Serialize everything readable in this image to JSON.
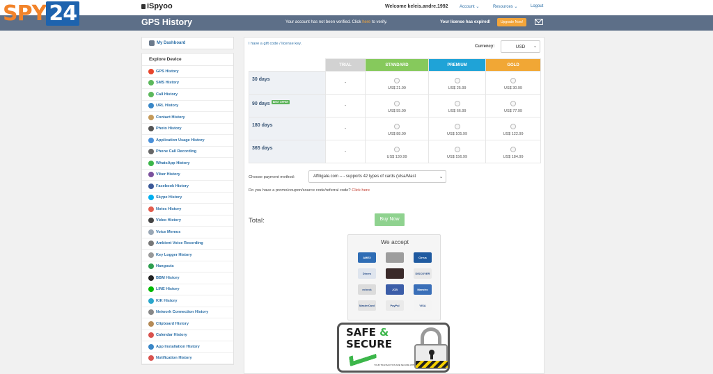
{
  "watermark": {
    "spy": "SPY",
    "num": "24"
  },
  "topbar": {
    "logo": "iSpyoo",
    "welcome": "Welcome keleis.andre.1992",
    "nav": [
      {
        "label": "Account",
        "has_dropdown": true
      },
      {
        "label": "Resources",
        "has_dropdown": true
      },
      {
        "label": "Logout",
        "has_dropdown": false
      }
    ],
    "chevron": "⌄"
  },
  "header": {
    "title": "GPS History",
    "verify_before": "Your account has not been verified. Click ",
    "verify_link": "here",
    "verify_after": " to verify.",
    "license_text": "Your license has expired!",
    "upgrade_label": "Upgrade Now!"
  },
  "sidebar": {
    "dashboard": "My Dashboard",
    "explore_title": "Explore Device",
    "items": [
      {
        "label": "GPS History",
        "icon": "map-pin-icon",
        "color": "#e8452c"
      },
      {
        "label": "SMS History",
        "icon": "sms-icon",
        "color": "#5cb85c"
      },
      {
        "label": "Call History",
        "icon": "phone-icon",
        "color": "#5cb85c"
      },
      {
        "label": "URL History",
        "icon": "globe-icon",
        "color": "#3a87c7"
      },
      {
        "label": "Contact History",
        "icon": "contacts-icon",
        "color": "#c59a5a"
      },
      {
        "label": "Photo History",
        "icon": "camera-icon",
        "color": "#555555"
      },
      {
        "label": "Application Usage History",
        "icon": "app-icon",
        "color": "#4a90d9"
      },
      {
        "label": "Phone Call Recording",
        "icon": "recorder-icon",
        "color": "#666666"
      },
      {
        "label": "WhatsApp History",
        "icon": "whatsapp-icon",
        "color": "#3cb64a"
      },
      {
        "label": "Viber History",
        "icon": "viber-icon",
        "color": "#7b519d"
      },
      {
        "label": "Facebook History",
        "icon": "facebook-icon",
        "color": "#3b5998"
      },
      {
        "label": "Skype History",
        "icon": "skype-icon",
        "color": "#00aff0"
      },
      {
        "label": "Notes History",
        "icon": "notes-icon",
        "color": "#e35d4e"
      },
      {
        "label": "Video History",
        "icon": "video-icon",
        "color": "#444444"
      },
      {
        "label": "Voice Memos",
        "icon": "microphone-icon",
        "color": "#9aa7b5"
      },
      {
        "label": "Ambient Voice Recording",
        "icon": "ambient-icon",
        "color": "#777777"
      },
      {
        "label": "Key Logger History",
        "icon": "keyboard-icon",
        "color": "#999999"
      },
      {
        "label": "Hangouts",
        "icon": "hangouts-icon",
        "color": "#2e9e4f"
      },
      {
        "label": "BBM History",
        "icon": "bbm-icon",
        "color": "#222222"
      },
      {
        "label": "LINE History",
        "icon": "line-icon",
        "color": "#00b900"
      },
      {
        "label": "KIK History",
        "icon": "kik-icon",
        "color": "#2aa7cc"
      },
      {
        "label": "Network Connection History",
        "icon": "wifi-icon",
        "color": "#888888"
      },
      {
        "label": "Clipboard History",
        "icon": "clipboard-icon",
        "color": "#b58b58"
      },
      {
        "label": "Calendar History",
        "icon": "calendar-icon",
        "color": "#d9534f"
      },
      {
        "label": "App Installation History",
        "icon": "install-icon",
        "color": "#3a87c7"
      },
      {
        "label": "Notification History",
        "icon": "notification-icon",
        "color": "#d9534f"
      }
    ]
  },
  "main": {
    "gift_link": "I have a gift code / license key.",
    "currency_label": "Currency:",
    "currency_value": "USD",
    "plans": [
      "TRIAL",
      "STANDARD",
      "PREMIUM",
      "GOLD"
    ],
    "rows": [
      {
        "period": "30 days",
        "badge": "",
        "trial": "-",
        "prices": [
          "US$ 21.99",
          "US$ 25.99",
          "US$ 30.99"
        ]
      },
      {
        "period": "90 days",
        "badge": "BEST OFFER",
        "trial": "-",
        "prices": [
          "US$ 55.99",
          "US$ 66.99",
          "US$ 77.99"
        ]
      },
      {
        "period": "180 days",
        "badge": "",
        "trial": "-",
        "prices": [
          "US$ 88.99",
          "US$ 105.99",
          "US$ 122.99"
        ]
      },
      {
        "period": "365 days",
        "badge": "",
        "trial": "-",
        "prices": [
          "US$ 130.99",
          "US$ 156.99",
          "US$ 184.99"
        ]
      }
    ],
    "payment_label": "Choose payment method:",
    "payment_value": "Affiligate.com -- - supports 42 types of cards (Visa/Mast",
    "promo_text": "Do you have a promo/coupon/source code/referral code? ",
    "promo_link": "Click here",
    "total_label": "Total:",
    "buy_label": "Buy Now",
    "we_accept": "We accept",
    "cards": [
      {
        "name": "amex",
        "label": "AMEX",
        "color": "#2f6db5"
      },
      {
        "name": "card-silver",
        "label": "",
        "color": "#9d9d9d"
      },
      {
        "name": "cirrus",
        "label": "Cirrus",
        "color": "#1f5aa0"
      },
      {
        "name": "diners",
        "label": "Diners",
        "color": "#dfe5ee"
      },
      {
        "name": "card-dark",
        "label": "",
        "color": "#3a2a2a"
      },
      {
        "name": "discover",
        "label": "DISCOVER",
        "color": "#e9e9e9"
      },
      {
        "name": "echeck",
        "label": "echeck",
        "color": "#dcdcdc"
      },
      {
        "name": "jcb",
        "label": "JCB",
        "color": "#3b5da8"
      },
      {
        "name": "maestro",
        "label": "Maestro",
        "color": "#3a6fb8"
      },
      {
        "name": "mastercard",
        "label": "MasterCard",
        "color": "#e4e4e4"
      },
      {
        "name": "paypal",
        "label": "PayPal",
        "color": "#eaeaea"
      },
      {
        "name": "visa",
        "label": "VISA",
        "color": "#f4f4f4"
      }
    ],
    "safe": {
      "line1": "SAFE",
      "amp": "&",
      "line2": "SECURE",
      "fine": "YOUR TRANSACTION ARE SECURE WITH SSL"
    }
  }
}
